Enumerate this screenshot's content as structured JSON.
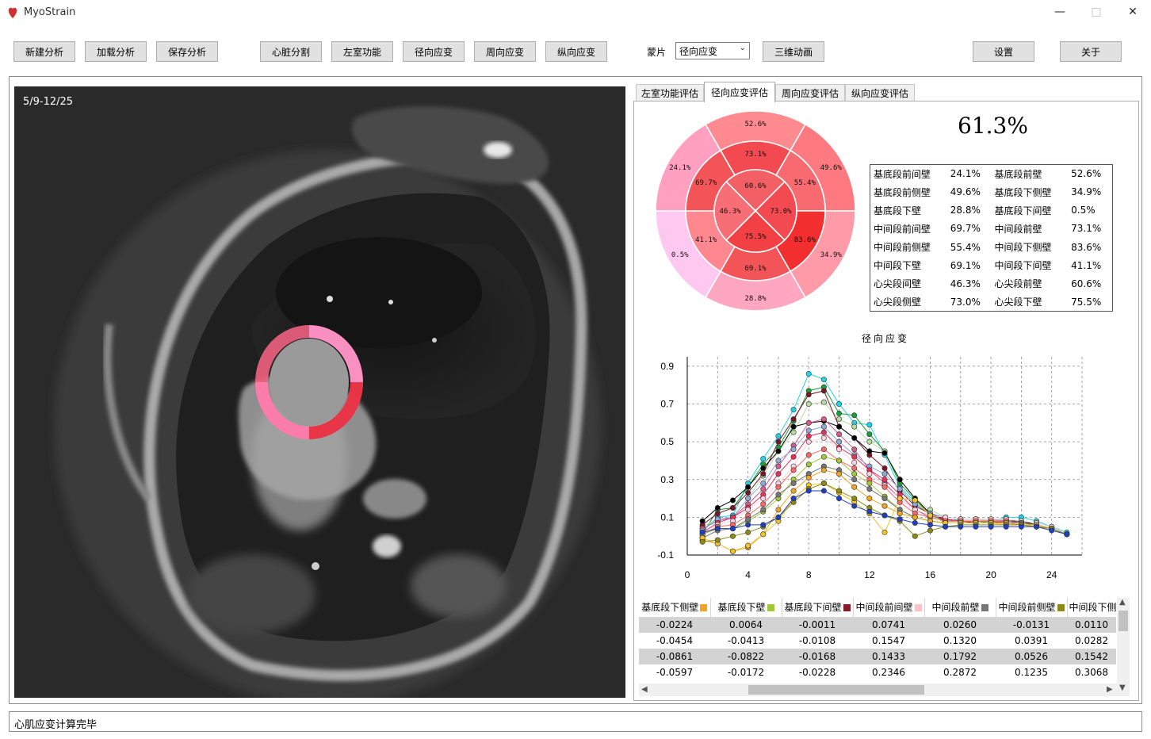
{
  "window": {
    "title": "MyoStrain"
  },
  "toolbar": {
    "new_analysis": "新建分析",
    "load_analysis": "加载分析",
    "save_analysis": "保存分析",
    "heart_segmentation": "心脏分割",
    "lv_function": "左室功能",
    "radial_strain": "径向应变",
    "circumferential_strain": "周向应变",
    "longitudinal_strain": "纵向应变",
    "overlay_label": "蒙片",
    "overlay_value": "径向应变",
    "animation_3d": "三维动画",
    "settings": "设置",
    "about": "关于"
  },
  "image_panel": {
    "label": "5/9-12/25"
  },
  "tabs": [
    "左室功能评估",
    "径向应变评估",
    "周向应变评估",
    "纵向应变评估"
  ],
  "active_tab": 1,
  "overall_value": "61.3%",
  "bullseye": {
    "outer": [
      "52.6%",
      "49.6%",
      "34.9%",
      "28.8%",
      "0.5%",
      "24.1%"
    ],
    "mid": [
      "73.1%",
      "55.4%",
      "83.6%",
      "69.1%",
      "41.1%",
      "69.7%"
    ],
    "inner": [
      "60.6%",
      "73.0%",
      "75.5%",
      "46.3%"
    ],
    "colors": {
      "outer": [
        "#ff8a90",
        "#ff7a80",
        "#ff9aa8",
        "#ffa6c0",
        "#ffc8f0",
        "#ffa0c0"
      ],
      "mid": [
        "#f24a50",
        "#f66a70",
        "#f22e2e",
        "#f25458",
        "#ff8890",
        "#f25458"
      ],
      "inner": [
        "#f26065",
        "#f24a50",
        "#f24045",
        "#f76e76"
      ]
    }
  },
  "segment_table": [
    [
      "基底段前间壁",
      "24.1%",
      "基底段前壁",
      "52.6%"
    ],
    [
      "基底段前侧壁",
      "49.6%",
      "基底段下侧壁",
      "34.9%"
    ],
    [
      "基底段下壁",
      "28.8%",
      "基底段下间壁",
      "0.5%"
    ],
    [
      "中间段前间壁",
      "69.7%",
      "中间段前壁",
      "73.1%"
    ],
    [
      "中间段前侧壁",
      "55.4%",
      "中间段下侧壁",
      "83.6%"
    ],
    [
      "中间段下壁",
      "69.1%",
      "中间段下间壁",
      "41.1%"
    ],
    [
      "心尖段间壁",
      "46.3%",
      "心尖段前壁",
      "60.6%"
    ],
    [
      "心尖段侧壁",
      "73.0%",
      "心尖段下壁",
      "75.5%"
    ]
  ],
  "chart_data": {
    "type": "line",
    "title": "径向应变",
    "xlabel": "",
    "ylabel": "",
    "xlim": [
      0,
      26
    ],
    "ylim": [
      -0.1,
      0.95
    ],
    "xticks": [
      0,
      4,
      8,
      12,
      16,
      20,
      24
    ],
    "yticks": [
      -0.1,
      0.1,
      0.3,
      0.5,
      0.7,
      0.9
    ],
    "grid": true,
    "x": [
      1,
      2,
      3,
      4,
      5,
      6,
      7,
      8,
      9,
      10,
      11,
      12,
      13,
      14,
      15,
      16,
      17,
      18,
      19,
      20,
      21,
      22,
      23,
      24,
      25
    ],
    "series": [
      {
        "color": "#22d3e6",
        "values": [
          0.03,
          0.1,
          0.11,
          0.28,
          0.41,
          0.53,
          0.67,
          0.86,
          0.83,
          0.7,
          0.6,
          0.59,
          0.43,
          0.26,
          0.18,
          0.11,
          0.08,
          0.09,
          0.09,
          0.08,
          0.1,
          0.1,
          0.08,
          0.05,
          0.02
        ]
      },
      {
        "color": "#1a9e3a",
        "values": [
          0.01,
          0.14,
          0.15,
          0.26,
          0.38,
          0.47,
          0.61,
          0.77,
          0.79,
          0.65,
          0.64,
          0.54,
          0.45,
          0.28,
          0.19,
          0.12,
          0.09,
          0.08,
          0.08,
          0.07,
          0.08,
          0.08,
          0.06,
          0.04,
          0.01
        ]
      },
      {
        "color": "#b8d9a0",
        "values": [
          0.05,
          0.09,
          0.1,
          0.2,
          0.32,
          0.45,
          0.55,
          0.7,
          0.71,
          0.62,
          0.58,
          0.5,
          0.45,
          0.3,
          0.2,
          0.14,
          0.1,
          0.09,
          0.09,
          0.08,
          0.09,
          0.08,
          0.06,
          0.04,
          0.01
        ]
      },
      {
        "color": "#7a1528",
        "values": [
          0.06,
          0.12,
          0.15,
          0.23,
          0.33,
          0.5,
          0.62,
          0.75,
          0.77,
          0.58,
          0.52,
          0.43,
          0.36,
          0.24,
          0.16,
          0.12,
          0.08,
          0.08,
          0.07,
          0.07,
          0.07,
          0.07,
          0.06,
          0.04,
          0.01
        ]
      },
      {
        "color": "#000000",
        "values": [
          0.08,
          0.15,
          0.19,
          0.26,
          0.36,
          0.45,
          0.58,
          0.6,
          0.61,
          0.58,
          0.52,
          0.45,
          0.44,
          0.3,
          0.2,
          0.12,
          0.09,
          0.08,
          0.08,
          0.08,
          0.08,
          0.08,
          0.06,
          0.04,
          0.01
        ]
      },
      {
        "color": "#d85a8a",
        "values": [
          0.04,
          0.08,
          0.1,
          0.17,
          0.25,
          0.37,
          0.48,
          0.6,
          0.62,
          0.54,
          0.46,
          0.35,
          0.28,
          0.2,
          0.14,
          0.1,
          0.08,
          0.08,
          0.08,
          0.08,
          0.08,
          0.07,
          0.06,
          0.04,
          0.01
        ]
      },
      {
        "color": "#8fa8d8",
        "values": [
          0.03,
          0.09,
          0.1,
          0.2,
          0.28,
          0.4,
          0.46,
          0.56,
          0.58,
          0.5,
          0.43,
          0.37,
          0.33,
          0.25,
          0.17,
          0.12,
          0.1,
          0.09,
          0.09,
          0.09,
          0.08,
          0.07,
          0.06,
          0.04,
          0.01
        ]
      },
      {
        "color": "#e8305a",
        "values": [
          0.02,
          0.07,
          0.1,
          0.15,
          0.22,
          0.33,
          0.42,
          0.53,
          0.55,
          0.47,
          0.42,
          0.35,
          0.3,
          0.22,
          0.14,
          0.11,
          0.09,
          0.08,
          0.08,
          0.08,
          0.07,
          0.07,
          0.06,
          0.04,
          0.01
        ]
      },
      {
        "color": "#ffd1de",
        "values": [
          0.0,
          0.06,
          0.08,
          0.14,
          0.2,
          0.28,
          0.37,
          0.5,
          0.52,
          0.46,
          0.39,
          0.33,
          0.27,
          0.2,
          0.14,
          0.11,
          0.1,
          0.09,
          0.09,
          0.09,
          0.09,
          0.08,
          0.07,
          0.05,
          0.01
        ]
      },
      {
        "color": "#ff6666",
        "values": [
          0.01,
          0.05,
          0.06,
          0.11,
          0.17,
          0.26,
          0.35,
          0.43,
          0.46,
          0.4,
          0.36,
          0.3,
          0.26,
          0.18,
          0.12,
          0.1,
          0.08,
          0.08,
          0.08,
          0.08,
          0.08,
          0.07,
          0.06,
          0.04,
          0.01
        ]
      },
      {
        "color": "#a2c837",
        "values": [
          0.01,
          0.04,
          0.04,
          0.08,
          0.13,
          0.2,
          0.3,
          0.38,
          0.42,
          0.4,
          0.33,
          0.28,
          0.21,
          0.14,
          0.1,
          0.08,
          0.07,
          0.07,
          0.07,
          0.07,
          0.07,
          0.07,
          0.06,
          0.04,
          0.01
        ]
      },
      {
        "color": "#777777",
        "values": [
          -0.01,
          0.03,
          0.04,
          0.09,
          0.14,
          0.22,
          0.28,
          0.33,
          0.37,
          0.35,
          0.3,
          0.25,
          0.2,
          0.14,
          0.1,
          0.08,
          0.07,
          0.07,
          0.07,
          0.07,
          0.07,
          0.07,
          0.06,
          0.04,
          0.01
        ]
      },
      {
        "color": "#f2a520",
        "values": [
          -0.02,
          -0.04,
          -0.08,
          -0.06,
          0.01,
          0.14,
          0.24,
          0.31,
          0.35,
          0.33,
          0.26,
          0.2,
          0.16,
          0.12,
          0.1,
          0.08,
          0.07,
          0.07,
          0.07,
          0.07,
          0.07,
          0.06,
          0.06,
          0.04,
          0.01
        ]
      },
      {
        "color": "#f2c428",
        "values": [
          -0.01,
          -0.04,
          -0.08,
          -0.05,
          0.01,
          0.08,
          0.2,
          0.27,
          0.28,
          0.23,
          0.18,
          0.12,
          0.02,
          0.2,
          0.19,
          0.11,
          0.07,
          0.07,
          0.07,
          0.07,
          0.06,
          0.06,
          0.05,
          0.04,
          0.01
        ]
      },
      {
        "color": "#8c8a14",
        "values": [
          -0.03,
          -0.02,
          0.0,
          0.02,
          0.05,
          0.1,
          0.18,
          0.25,
          0.28,
          0.24,
          0.2,
          0.15,
          0.11,
          0.08,
          0.0,
          0.03,
          0.05,
          0.06,
          0.06,
          0.06,
          0.06,
          0.06,
          0.05,
          0.04,
          0.01
        ]
      },
      {
        "color": "#1e3fc0",
        "values": [
          0.02,
          0.04,
          0.04,
          0.06,
          0.06,
          0.1,
          0.2,
          0.24,
          0.24,
          0.2,
          0.16,
          0.13,
          0.11,
          0.09,
          0.07,
          0.06,
          0.05,
          0.05,
          0.05,
          0.05,
          0.05,
          0.05,
          0.05,
          0.03,
          0.01
        ]
      }
    ]
  },
  "data_grid": {
    "columns": [
      {
        "name": "基底段下侧壁",
        "color": "#f2a520"
      },
      {
        "name": "基底段下壁",
        "color": "#a2c837"
      },
      {
        "name": "基底段下间壁",
        "color": "#8b1a2a"
      },
      {
        "name": "中间段前间壁",
        "color": "#ffc0cb"
      },
      {
        "name": "中间段前壁",
        "color": "#777777"
      },
      {
        "name": "中间段前侧壁",
        "color": "#8c8a14"
      },
      {
        "name": "中间段下侧",
        "color": ""
      }
    ],
    "rows": [
      [
        "-0.0224",
        "0.0064",
        "-0.0011",
        "0.0741",
        "0.0260",
        "-0.0131",
        "0.0110"
      ],
      [
        "-0.0454",
        "-0.0413",
        "-0.0108",
        "0.1547",
        "0.1320",
        "0.0391",
        "0.0282"
      ],
      [
        "-0.0861",
        "-0.0822",
        "-0.0168",
        "0.1433",
        "0.1792",
        "0.0526",
        "0.1542"
      ],
      [
        "-0.0597",
        "-0.0172",
        "-0.0228",
        "0.2346",
        "0.2872",
        "0.1235",
        "0.3068"
      ]
    ]
  },
  "status": {
    "message": "心肌应变计算完毕"
  }
}
